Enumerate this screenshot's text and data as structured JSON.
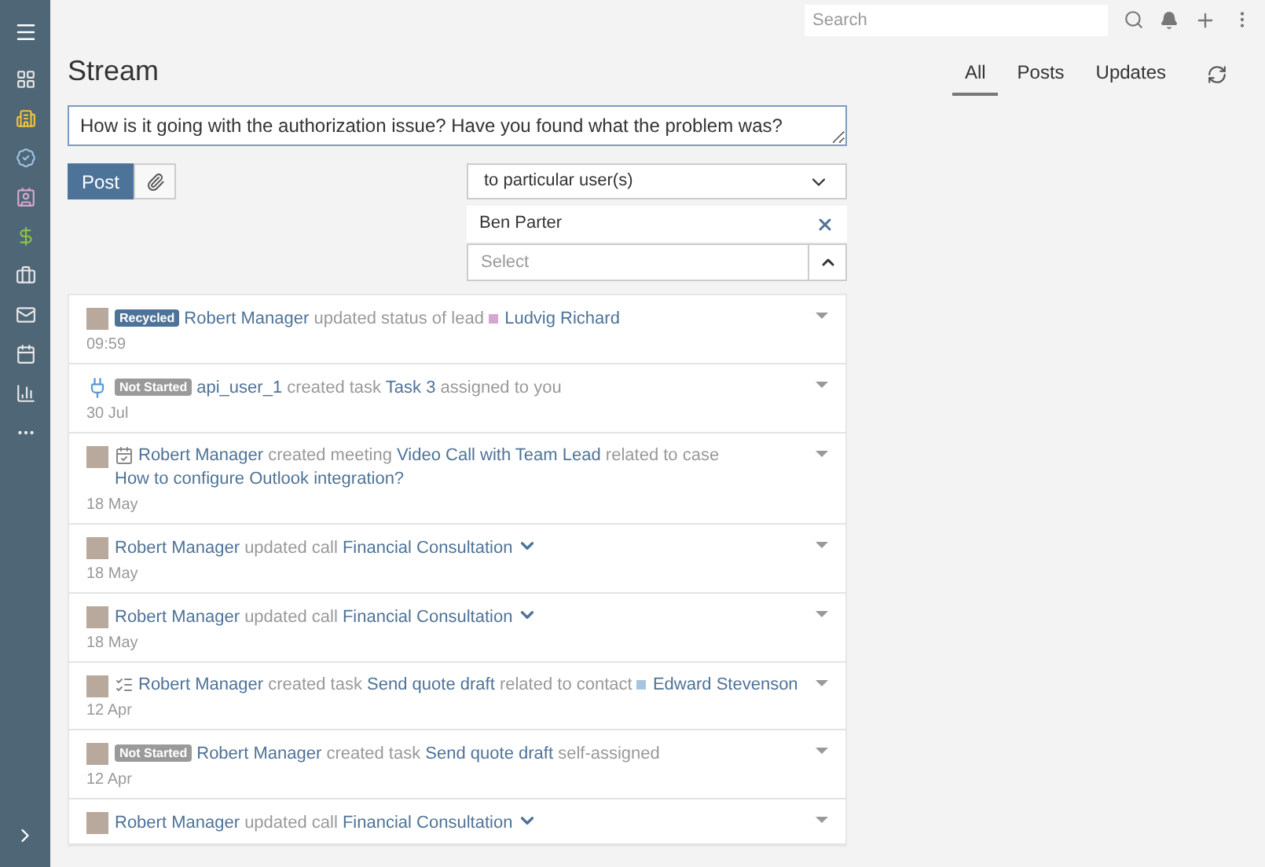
{
  "topbar": {
    "search": {
      "placeholder": "Search"
    }
  },
  "page": {
    "title": "Stream"
  },
  "tabs": [
    {
      "label": "All",
      "selected": true
    },
    {
      "label": "Posts",
      "selected": false
    },
    {
      "label": "Updates",
      "selected": false
    }
  ],
  "composer": {
    "value": "How is it going with the authorization issue? Have you found what the problem was?",
    "post_button": "Post",
    "audience": "to particular user(s)",
    "users": [
      "Ben Parter"
    ],
    "select_placeholder": "Select"
  },
  "stream": [
    {
      "avatar": {
        "kind": "photo"
      },
      "badge": {
        "label": "Recycled",
        "color": "#4e7398"
      },
      "parts": [
        {
          "kind": "link",
          "text": "Robert Manager"
        },
        {
          "kind": "muted",
          "text": "updated status of lead"
        },
        {
          "kind": "dot",
          "color": "#d7a6cf"
        },
        {
          "kind": "link",
          "text": "Ludvig Richard"
        }
      ],
      "time": "09:59"
    },
    {
      "avatar": {
        "kind": "api"
      },
      "badge": {
        "label": "Not Started",
        "color": "#9a9a9a"
      },
      "parts": [
        {
          "kind": "link",
          "text": "api_user_1"
        },
        {
          "kind": "muted",
          "text": "created task"
        },
        {
          "kind": "link",
          "text": "Task 3"
        },
        {
          "kind": "muted",
          "text": "assigned to you"
        }
      ],
      "time": "30 Jul"
    },
    {
      "avatar": {
        "kind": "photo"
      },
      "type_icon": {
        "kind": "meeting"
      },
      "parts": [
        {
          "kind": "link",
          "text": "Robert Manager"
        },
        {
          "kind": "muted",
          "text": "created meeting"
        },
        {
          "kind": "link",
          "text": "Video Call with Team Lead"
        },
        {
          "kind": "muted",
          "text": "related to case"
        },
        {
          "kind": "link",
          "text": "How to configure Outlook integration?"
        }
      ],
      "time": "18 May"
    },
    {
      "avatar": {
        "kind": "photo"
      },
      "parts": [
        {
          "kind": "link",
          "text": "Robert Manager"
        },
        {
          "kind": "muted",
          "text": "updated call"
        },
        {
          "kind": "link",
          "text": "Financial Consultation"
        },
        {
          "kind": "expand"
        }
      ],
      "time": "18 May"
    },
    {
      "avatar": {
        "kind": "photo"
      },
      "parts": [
        {
          "kind": "link",
          "text": "Robert Manager"
        },
        {
          "kind": "muted",
          "text": "updated call"
        },
        {
          "kind": "link",
          "text": "Financial Consultation"
        },
        {
          "kind": "expand"
        }
      ],
      "time": "18 May"
    },
    {
      "avatar": {
        "kind": "photo"
      },
      "type_icon": {
        "kind": "task"
      },
      "parts": [
        {
          "kind": "link",
          "text": "Robert Manager"
        },
        {
          "kind": "muted",
          "text": "created task"
        },
        {
          "kind": "link",
          "text": "Send quote draft"
        },
        {
          "kind": "muted",
          "text": "related to contact"
        },
        {
          "kind": "dot",
          "color": "#a7c4e0"
        },
        {
          "kind": "link",
          "text": "Edward Stevenson"
        }
      ],
      "time": "12 Apr"
    },
    {
      "avatar": {
        "kind": "photo"
      },
      "badge": {
        "label": "Not Started",
        "color": "#9a9a9a"
      },
      "parts": [
        {
          "kind": "link",
          "text": "Robert Manager"
        },
        {
          "kind": "muted",
          "text": "created task"
        },
        {
          "kind": "link",
          "text": "Send quote draft"
        },
        {
          "kind": "muted",
          "text": "self-assigned"
        }
      ],
      "time": "12 Apr"
    },
    {
      "avatar": {
        "kind": "photo"
      },
      "parts": [
        {
          "kind": "link",
          "text": "Robert Manager"
        },
        {
          "kind": "muted",
          "text": "updated call"
        },
        {
          "kind": "link",
          "text": "Financial Consultation"
        },
        {
          "kind": "expand"
        }
      ]
    }
  ]
}
